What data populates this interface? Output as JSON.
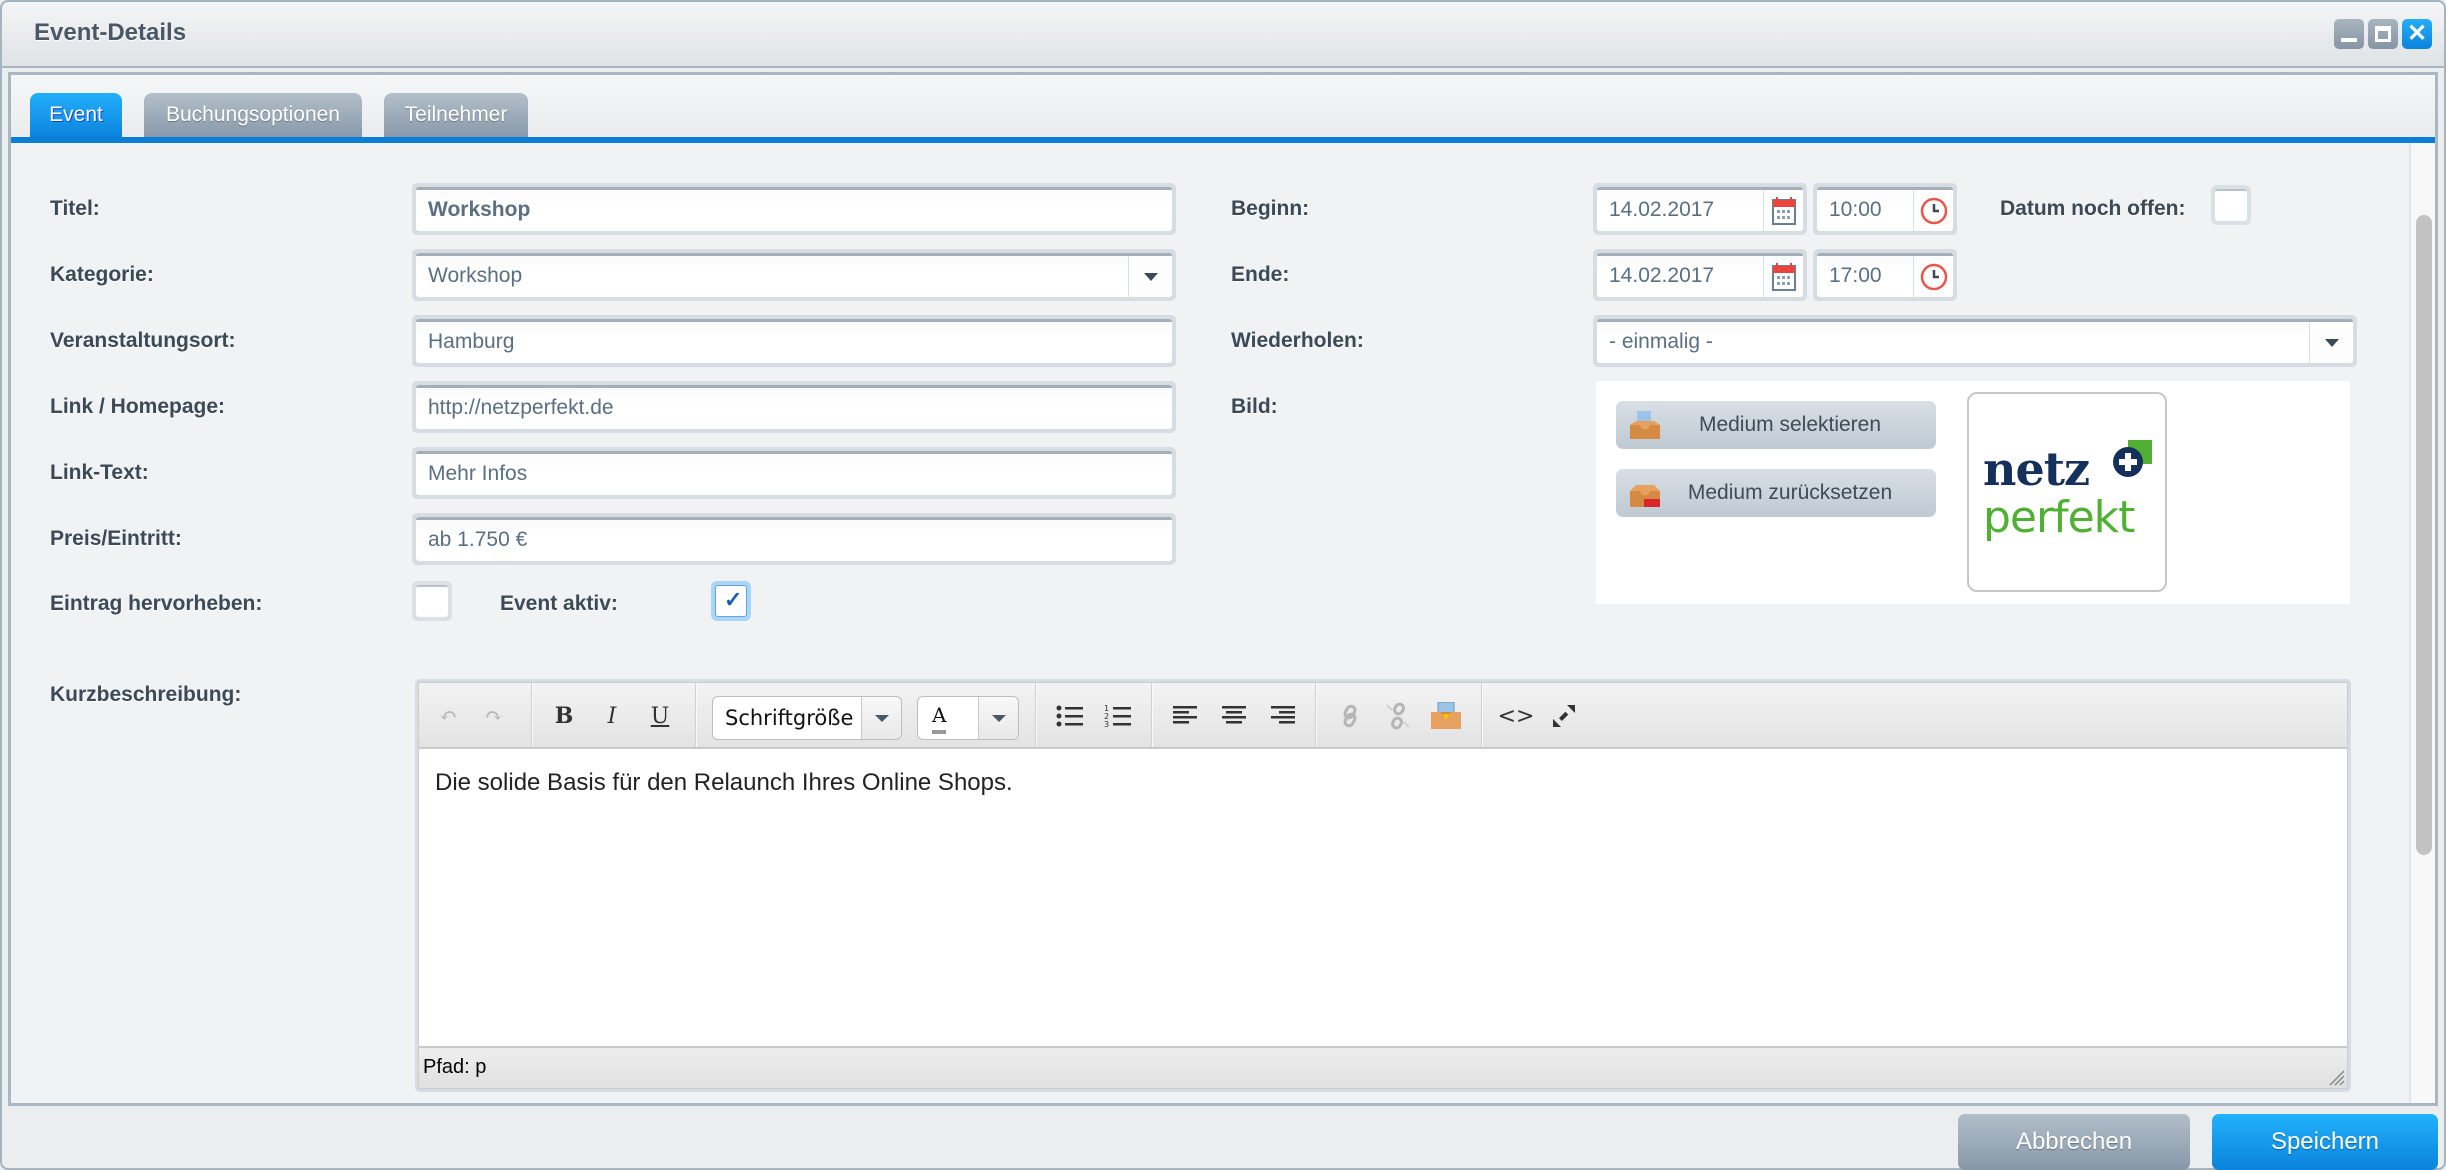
{
  "window": {
    "title": "Event-Details",
    "controls": {
      "minimize": "minimize-icon",
      "maximize": "maximize-icon",
      "close": "close-icon"
    }
  },
  "tabs": [
    {
      "label": "Event",
      "active": true
    },
    {
      "label": "Buchungsoptionen",
      "active": false
    },
    {
      "label": "Teilnehmer",
      "active": false
    }
  ],
  "form_left": {
    "titel": {
      "label": "Titel:",
      "value": "Workshop"
    },
    "kategorie": {
      "label": "Kategorie:",
      "value": "Workshop"
    },
    "veranstaltungsort": {
      "label": "Veranstaltungsort:",
      "value": "Hamburg"
    },
    "link": {
      "label": "Link / Homepage:",
      "value": "http://netzperfekt.de"
    },
    "link_text": {
      "label": "Link-Text:",
      "value": "Mehr Infos"
    },
    "preis": {
      "label": "Preis/Eintritt:",
      "value": "ab 1.750 €"
    },
    "hervorheben": {
      "label": "Eintrag hervorheben:",
      "checked": false
    },
    "aktiv": {
      "label": "Event aktiv:",
      "checked": true
    }
  },
  "form_right": {
    "beginn": {
      "label": "Beginn:",
      "date": "14.02.2017",
      "time": "10:00"
    },
    "datum_offen": {
      "label": "Datum noch offen:",
      "checked": false
    },
    "ende": {
      "label": "Ende:",
      "date": "14.02.2017",
      "time": "17:00"
    },
    "wiederholen": {
      "label": "Wiederholen:",
      "value": "- einmalig -"
    },
    "bild": {
      "label": "Bild:",
      "select_button": "Medium selektieren",
      "reset_button": "Medium zurücksetzen",
      "logo_line1": "netz",
      "logo_line2": "perfekt"
    }
  },
  "kurzbeschreibung": {
    "label": "Kurzbeschreibung:",
    "toolbar": {
      "font_size_select": "Schriftgröße",
      "text_color_glyph": "A",
      "buttons": [
        "undo-icon",
        "redo-icon",
        "bold-icon",
        "italic-icon",
        "underline-icon",
        "bullet-list-icon",
        "numbered-list-icon",
        "align-left-icon",
        "align-center-icon",
        "align-right-icon",
        "link-icon",
        "unlink-icon",
        "media-icon",
        "source-code-icon",
        "fullscreen-icon"
      ]
    },
    "content": "Die solide Basis für den Relaunch Ihres Online Shops.",
    "path": "Pfad: p"
  },
  "footer": {
    "cancel": "Abbrechen",
    "save": "Speichern"
  },
  "colors": {
    "accent": "#0b84de",
    "tab_inactive": "#8e9eae",
    "label": "#3c4a58",
    "field_text": "#5a6f81",
    "logo_navy": "#15305a",
    "logo_green": "#4fb033"
  }
}
